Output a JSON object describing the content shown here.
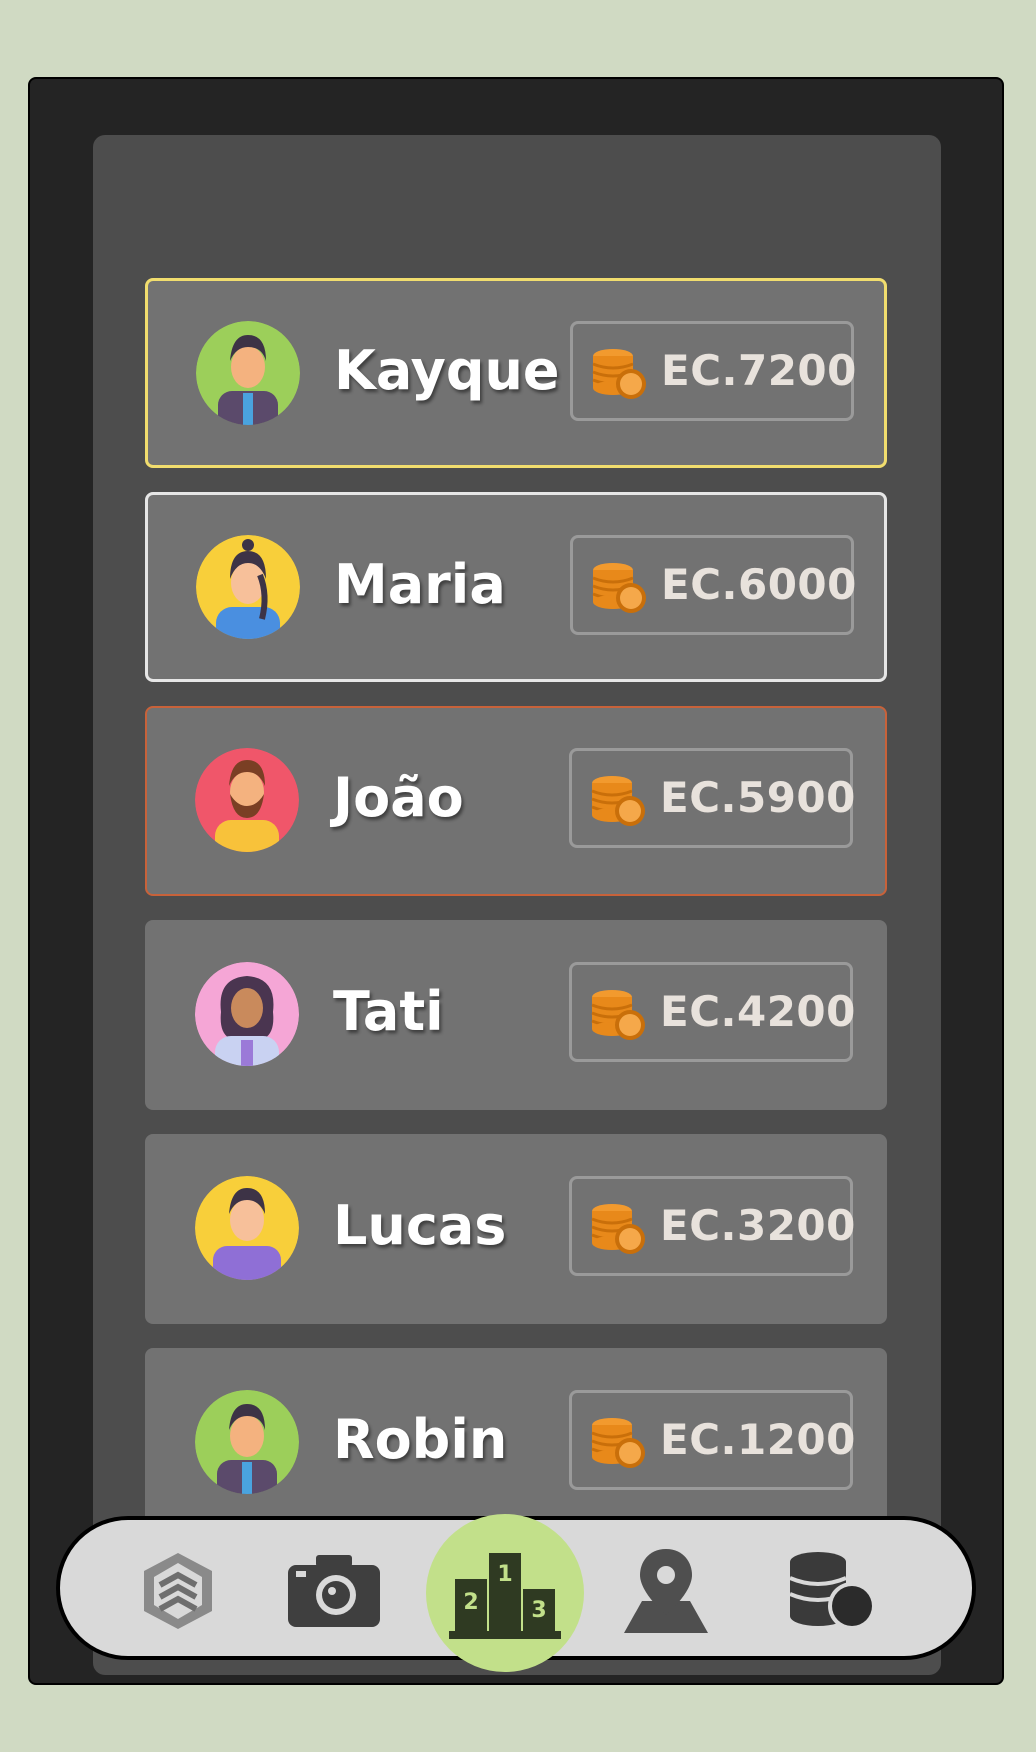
{
  "ranking": [
    {
      "name": "Kayque",
      "amount": "EC.7200",
      "avatar": "man-green-icon"
    },
    {
      "name": "Maria",
      "amount": "EC.6000",
      "avatar": "woman-yellow-icon"
    },
    {
      "name": "João",
      "amount": "EC.5900",
      "avatar": "bearded-man-red-icon"
    },
    {
      "name": "Tati",
      "amount": "EC.4200",
      "avatar": "woman-pink-icon"
    },
    {
      "name": "Lucas",
      "amount": "EC.3200",
      "avatar": "man-yellow-icon"
    },
    {
      "name": "Robin",
      "amount": "EC.1200",
      "avatar": "man-green-icon"
    }
  ],
  "nav": {
    "items": [
      "logo-icon",
      "camera-icon",
      "podium-icon",
      "map-pin-icon",
      "coins-icon"
    ],
    "active": "podium-icon"
  },
  "colors": {
    "background": "#d0dac3",
    "gold": "#f1dd6e",
    "silver": "#e6e6e6",
    "bronze": "#c8623a",
    "coin": "#e8891a",
    "active_nav": "#c2e08a"
  }
}
